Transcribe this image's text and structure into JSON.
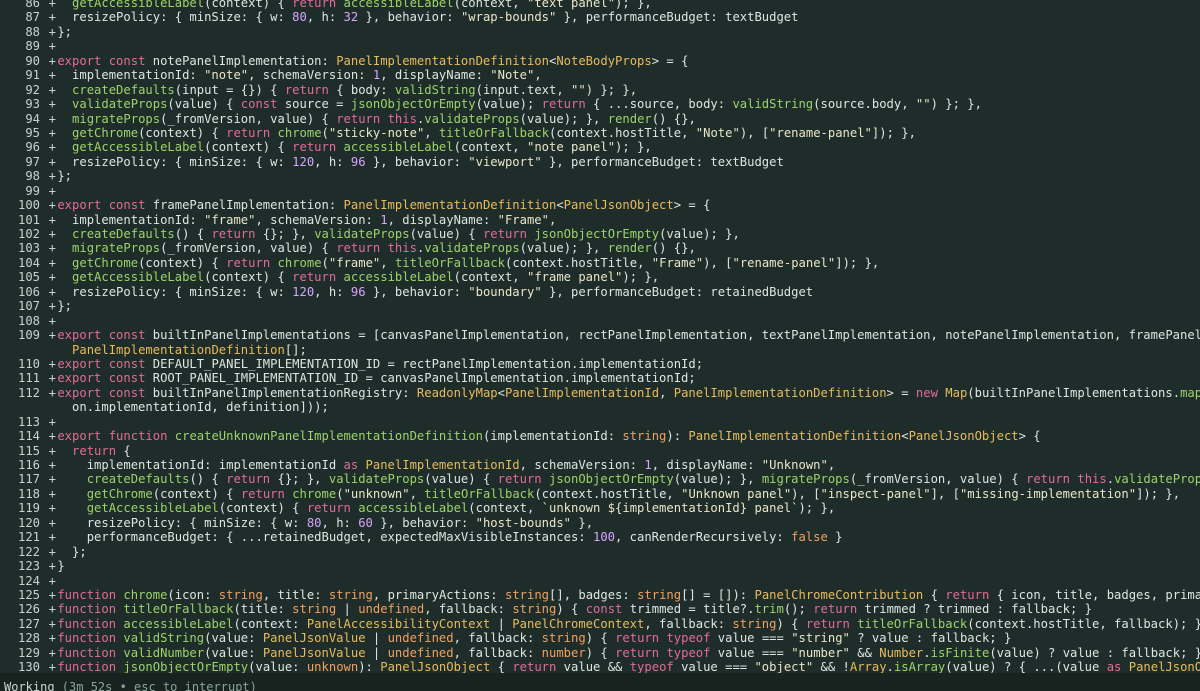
{
  "code_lines": [
    {
      "ln": "86",
      "marker": "+",
      "text": "  getAccessibleLabel(context) { return accessibleLabel(context, \"text panel\"); },"
    },
    {
      "ln": "87",
      "marker": "+",
      "text": "  resizePolicy: { minSize: { w: 80, h: 32 }, behavior: \"wrap-bounds\" }, performanceBudget: textBudget"
    },
    {
      "ln": "88",
      "marker": "+",
      "text": "};"
    },
    {
      "ln": "89",
      "marker": "+",
      "text": ""
    },
    {
      "ln": "90",
      "marker": "+",
      "text": "export const notePanelImplementation: PanelImplementationDefinition<NoteBodyProps> = {"
    },
    {
      "ln": "91",
      "marker": "+",
      "text": "  implementationId: \"note\", schemaVersion: 1, displayName: \"Note\","
    },
    {
      "ln": "92",
      "marker": "+",
      "text": "  createDefaults(input = {}) { return { body: validString(input.text, \"\") }; },"
    },
    {
      "ln": "93",
      "marker": "+",
      "text": "  validateProps(value) { const source = jsonObjectOrEmpty(value); return { ...source, body: validString(source.body, \"\") }; },"
    },
    {
      "ln": "94",
      "marker": "+",
      "text": "  migrateProps(_fromVersion, value) { return this.validateProps(value); }, render() {},"
    },
    {
      "ln": "95",
      "marker": "+",
      "text": "  getChrome(context) { return chrome(\"sticky-note\", titleOrFallback(context.hostTitle, \"Note\"), [\"rename-panel\"]); },"
    },
    {
      "ln": "96",
      "marker": "+",
      "text": "  getAccessibleLabel(context) { return accessibleLabel(context, \"note panel\"); },"
    },
    {
      "ln": "97",
      "marker": "+",
      "text": "  resizePolicy: { minSize: { w: 120, h: 96 }, behavior: \"viewport\" }, performanceBudget: textBudget"
    },
    {
      "ln": "98",
      "marker": "+",
      "text": "};"
    },
    {
      "ln": "99",
      "marker": "+",
      "text": ""
    },
    {
      "ln": "100",
      "marker": "+",
      "text": "export const framePanelImplementation: PanelImplementationDefinition<PanelJsonObject> = {"
    },
    {
      "ln": "101",
      "marker": "+",
      "text": "  implementationId: \"frame\", schemaVersion: 1, displayName: \"Frame\","
    },
    {
      "ln": "102",
      "marker": "+",
      "text": "  createDefaults() { return {}; }, validateProps(value) { return jsonObjectOrEmpty(value); },"
    },
    {
      "ln": "103",
      "marker": "+",
      "text": "  migrateProps(_fromVersion, value) { return this.validateProps(value); }, render() {},"
    },
    {
      "ln": "104",
      "marker": "+",
      "text": "  getChrome(context) { return chrome(\"frame\", titleOrFallback(context.hostTitle, \"Frame\"), [\"rename-panel\"]); },"
    },
    {
      "ln": "105",
      "marker": "+",
      "text": "  getAccessibleLabel(context) { return accessibleLabel(context, \"frame panel\"); },"
    },
    {
      "ln": "106",
      "marker": "+",
      "text": "  resizePolicy: { minSize: { w: 120, h: 96 }, behavior: \"boundary\" }, performanceBudget: retainedBudget"
    },
    {
      "ln": "107",
      "marker": "+",
      "text": "};"
    },
    {
      "ln": "108",
      "marker": "+",
      "text": ""
    },
    {
      "ln": "109",
      "marker": "+",
      "text": "export const builtInPanelImplementations = [canvasPanelImplementation, rectPanelImplementation, textPanelImplementation, notePanelImplementation, framePanelImplementation] sa"
    },
    {
      "ln": "",
      "marker": "",
      "text": "  PanelImplementationDefinition[];"
    },
    {
      "ln": "110",
      "marker": "+",
      "text": "export const DEFAULT_PANEL_IMPLEMENTATION_ID = rectPanelImplementation.implementationId;"
    },
    {
      "ln": "111",
      "marker": "+",
      "text": "export const ROOT_PANEL_IMPLEMENTATION_ID = canvasPanelImplementation.implementationId;"
    },
    {
      "ln": "112",
      "marker": "+",
      "text": "export const builtInPanelImplementationRegistry: ReadonlyMap<PanelImplementationId, PanelImplementationDefinition> = new Map(builtInPanelImplementations.map((definition) ⇒ ["
    },
    {
      "ln": "",
      "marker": "",
      "text": "  on.implementationId, definition]));"
    },
    {
      "ln": "113",
      "marker": "+",
      "text": ""
    },
    {
      "ln": "114",
      "marker": "+",
      "text": "export function createUnknownPanelImplementationDefinition(implementationId: string): PanelImplementationDefinition<PanelJsonObject> {"
    },
    {
      "ln": "115",
      "marker": "+",
      "text": "  return {"
    },
    {
      "ln": "116",
      "marker": "+",
      "text": "    implementationId: implementationId as PanelImplementationId, schemaVersion: 1, displayName: \"Unknown\","
    },
    {
      "ln": "117",
      "marker": "+",
      "text": "    createDefaults() { return {}; }, validateProps(value) { return jsonObjectOrEmpty(value); }, migrateProps(_fromVersion, value) { return this.validateProps(value); }, rende"
    },
    {
      "ln": "118",
      "marker": "+",
      "text": "    getChrome(context) { return chrome(\"unknown\", titleOrFallback(context.hostTitle, \"Unknown panel\"), [\"inspect-panel\"], [\"missing-implementation\"]); },"
    },
    {
      "ln": "119",
      "marker": "+",
      "text": "    getAccessibleLabel(context) { return accessibleLabel(context, `unknown ${implementationId} panel`); },"
    },
    {
      "ln": "120",
      "marker": "+",
      "text": "    resizePolicy: { minSize: { w: 80, h: 60 }, behavior: \"host-bounds\" },"
    },
    {
      "ln": "121",
      "marker": "+",
      "text": "    performanceBudget: { ...retainedBudget, expectedMaxVisibleInstances: 100, canRenderRecursively: false }"
    },
    {
      "ln": "122",
      "marker": "+",
      "text": "  };"
    },
    {
      "ln": "123",
      "marker": "+",
      "text": "}"
    },
    {
      "ln": "124",
      "marker": "+",
      "text": ""
    },
    {
      "ln": "125",
      "marker": "+",
      "text": "function chrome(icon: string, title: string, primaryActions: string[], badges: string[] = []): PanelChromeContribution { return { icon, title, badges, primaryActions }; }"
    },
    {
      "ln": "126",
      "marker": "+",
      "text": "function titleOrFallback(title: string | undefined, fallback: string) { const trimmed = title?.trim(); return trimmed ? trimmed : fallback; }"
    },
    {
      "ln": "127",
      "marker": "+",
      "text": "function accessibleLabel(context: PanelAccessibilityContext | PanelChromeContext, fallback: string) { return titleOrFallback(context.hostTitle, fallback); }"
    },
    {
      "ln": "128",
      "marker": "+",
      "text": "function validString(value: PanelJsonValue | undefined, fallback: string) { return typeof value === \"string\" ? value : fallback; }"
    },
    {
      "ln": "129",
      "marker": "+",
      "text": "function validNumber(value: PanelJsonValue | undefined, fallback: number) { return typeof value === \"number\" && Number.isFinite(value) ? value : fallback; }"
    },
    {
      "ln": "130",
      "marker": "+",
      "text": "function jsonObjectOrEmpty(value: unknown): PanelJsonObject { return value && typeof value === \"object\" && !Array.isArray(value) ? { ...(value as PanelJsonObject) } : {}; }"
    }
  ],
  "status": {
    "working_label": "Working",
    "rest": " (3m 52s • esc to interrupt)"
  }
}
